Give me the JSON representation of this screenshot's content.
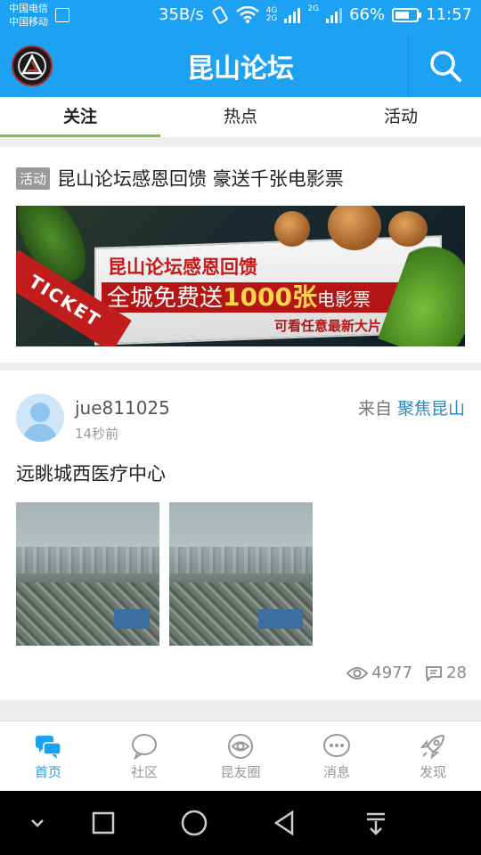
{
  "status_bar": {
    "carrier_1": "中国电信",
    "carrier_2": "中国移动",
    "net_speed": "35B/s",
    "net_4g": "4G",
    "net_2g_a": "2G",
    "net_2g_b": "2G",
    "battery_percent": "66%",
    "battery_level": 0.66,
    "time": "11:57"
  },
  "app_bar": {
    "title": "昆山论坛",
    "logo_icon": "linkin-park-logo-icon",
    "search_icon": "search-icon"
  },
  "tabs": [
    {
      "label": "关注",
      "active": true
    },
    {
      "label": "热点",
      "active": false
    },
    {
      "label": "活动",
      "active": false
    }
  ],
  "activity_card": {
    "tag": "活动",
    "title": "昆山论坛感恩回馈 豪送千张电影票",
    "banner": {
      "line1": "昆山论坛感恩回馈",
      "line2_prefix": "全城免费送",
      "line2_highlight": "1000张",
      "line2_suffix": "电影票",
      "line3": "可看任意最新大片",
      "ribbon": "TICKET"
    }
  },
  "post_card": {
    "username": "jue811025",
    "time": "14秒前",
    "from_label": "来自",
    "from_source": "聚焦昆山",
    "title": "远眺城西医疗中心",
    "photo_count": 2,
    "views": "4977",
    "comments": "28"
  },
  "bottom_nav": [
    {
      "label": "首页",
      "icon": "chat-bubbles-icon",
      "active": true
    },
    {
      "label": "社区",
      "icon": "speech-bubble-icon",
      "active": false
    },
    {
      "label": "昆友圈",
      "icon": "eye-circle-icon",
      "active": false
    },
    {
      "label": "消息",
      "icon": "message-dots-icon",
      "active": false
    },
    {
      "label": "发现",
      "icon": "rocket-icon",
      "active": false
    }
  ],
  "colors": {
    "primary": "#1da1f2",
    "tab_indicator": "#7ac143",
    "source_link": "#2a8ac6"
  }
}
